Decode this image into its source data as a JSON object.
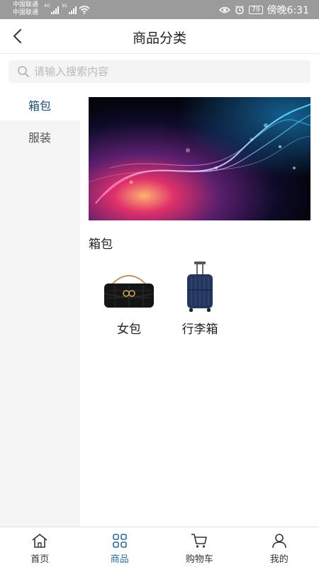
{
  "status_bar": {
    "carrier_1": "中国联通",
    "carrier_2": "中国联通",
    "net_1": "4G",
    "net_2": "3G",
    "battery": "79",
    "time": "傍晚6:31"
  },
  "header": {
    "title": "商品分类"
  },
  "search": {
    "placeholder": "请输入搜索内容"
  },
  "sidebar": {
    "items": [
      {
        "label": "箱包",
        "active": true
      },
      {
        "label": "服装",
        "active": false
      }
    ]
  },
  "main": {
    "section_title": "箱包",
    "products": [
      {
        "name": "女包",
        "icon": "black-handbag"
      },
      {
        "name": "行李箱",
        "icon": "navy-suitcase"
      }
    ]
  },
  "tabs": [
    {
      "label": "首页",
      "icon": "home-icon",
      "active": false
    },
    {
      "label": "商品",
      "icon": "grid-icon",
      "active": true
    },
    {
      "label": "购物车",
      "icon": "cart-icon",
      "active": false
    },
    {
      "label": "我的",
      "icon": "user-icon",
      "active": false
    }
  ],
  "colors": {
    "accent": "#2e6a9b",
    "active_category": "#1a4f73",
    "status_bar": "#9b9b9b",
    "sidebar_bg": "#f5f5f5"
  }
}
